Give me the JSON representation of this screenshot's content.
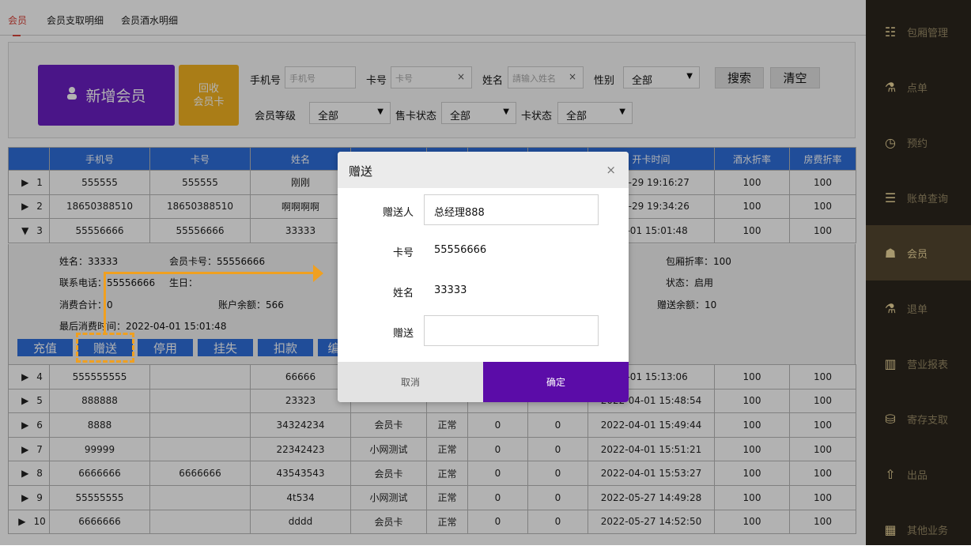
{
  "tabs": [
    "会员",
    "会员支取明细",
    "会员酒水明细"
  ],
  "buttons": {
    "new_member": "新增会员",
    "recycle_line1": "回收",
    "recycle_line2": "会员卡",
    "search": "搜索",
    "clear": "清空"
  },
  "filters": {
    "phone_label": "手机号",
    "phone_placeholder": "手机号",
    "card_label": "卡号",
    "card_placeholder": "卡号",
    "name_label": "姓名",
    "name_placeholder": "請输入姓名",
    "gender_label": "性别",
    "gender_value": "全部",
    "level_label": "会员等级",
    "level_value": "全部",
    "sale_status_label": "售卡状态",
    "sale_status_value": "全部",
    "card_status_label": "卡状态",
    "card_status_value": "全部"
  },
  "table": {
    "headers": [
      "手机号",
      "卡号",
      "姓名",
      "",
      "",
      "",
      "",
      "开卡时间",
      "酒水折率",
      "房费折率"
    ],
    "rows_top": [
      {
        "no": "1",
        "toggle": "▶",
        "phone": "555555",
        "card": "555555",
        "name": "刚刚",
        "type": "",
        "status": "",
        "c1": "",
        "c2": "",
        "time": "-12-29 19:16:27",
        "drink": "100",
        "room": "100"
      },
      {
        "no": "2",
        "toggle": "▶",
        "phone": "18650388510",
        "card": "18650388510",
        "name": "啊啊啊啊",
        "type": "",
        "status": "",
        "c1": "",
        "c2": "",
        "time": "-12-29 19:34:26",
        "drink": "100",
        "room": "100"
      },
      {
        "no": "3",
        "toggle": "▼",
        "phone": "55556666",
        "card": "55556666",
        "name": "33333",
        "type": "",
        "status": "",
        "c1": "",
        "c2": "",
        "time": "04-01 15:01:48",
        "drink": "100",
        "room": "100"
      }
    ],
    "rows_bottom": [
      {
        "no": "4",
        "toggle": "▶",
        "phone": "555555555",
        "card": "",
        "name": "66666",
        "type": "",
        "status": "",
        "c1": "",
        "c2": "",
        "time": "04-01 15:13:06",
        "drink": "100",
        "room": "100"
      },
      {
        "no": "5",
        "toggle": "▶",
        "phone": "888888",
        "card": "",
        "name": "23323",
        "type": "",
        "status": "",
        "c1": "",
        "c2": "",
        "time": "2022-04-01 15:48:54",
        "drink": "100",
        "room": "100"
      },
      {
        "no": "6",
        "toggle": "▶",
        "phone": "8888",
        "card": "",
        "name": "34324234",
        "type": "会员卡",
        "status": "正常",
        "c1": "0",
        "c2": "0",
        "time": "2022-04-01 15:49:44",
        "drink": "100",
        "room": "100"
      },
      {
        "no": "7",
        "toggle": "▶",
        "phone": "99999",
        "card": "",
        "name": "22342423",
        "type": "小网测试",
        "status": "正常",
        "c1": "0",
        "c2": "0",
        "time": "2022-04-01 15:51:21",
        "drink": "100",
        "room": "100"
      },
      {
        "no": "8",
        "toggle": "▶",
        "phone": "6666666",
        "card": "6666666",
        "name": "43543543",
        "type": "会员卡",
        "status": "正常",
        "c1": "0",
        "c2": "0",
        "time": "2022-04-01 15:53:27",
        "drink": "100",
        "room": "100"
      },
      {
        "no": "9",
        "toggle": "▶",
        "phone": "55555555",
        "card": "",
        "name": "4t534",
        "type": "小网测试",
        "status": "正常",
        "c1": "0",
        "c2": "0",
        "time": "2022-05-27 14:49:28",
        "drink": "100",
        "room": "100"
      },
      {
        "no": "10",
        "toggle": "▶",
        "phone": "6666666",
        "card": "",
        "name": "dddd",
        "type": "会员卡",
        "status": "正常",
        "c1": "0",
        "c2": "0",
        "time": "2022-05-27 14:52:50",
        "drink": "100",
        "room": "100"
      }
    ]
  },
  "detail": {
    "name": "姓名：33333",
    "card_no": "会员卡号：55556666",
    "phone": "联系电话：55556666",
    "birthday": "生日：",
    "consume_total": "消费合计：0",
    "balance": "账户余额：566",
    "last_consume": "最后消费时间：2022-04-01 15:01:48",
    "room_discount": "包厢折率：100",
    "state": "状态：启用",
    "gift_balance": "赠送余额：10",
    "actions": [
      "充值",
      "赠送",
      "停用",
      "挂失",
      "扣款",
      "编"
    ]
  },
  "dialog": {
    "title": "赠送",
    "close": "×",
    "giver_label": "赠送人",
    "giver_value": "总经理888",
    "card_label": "卡号",
    "card_value": "55556666",
    "name_label": "姓名",
    "name_value": "33333",
    "gift_label": "赠送",
    "gift_value": "",
    "cancel": "取消",
    "confirm": "确定"
  },
  "sidebar": [
    {
      "label": "包厢管理",
      "icon": "list-icon"
    },
    {
      "label": "点单",
      "icon": "order-icon"
    },
    {
      "label": "预约",
      "icon": "clock-icon"
    },
    {
      "label": "账单查询",
      "icon": "bill-icon"
    },
    {
      "label": "会员",
      "icon": "member-icon",
      "active": true
    },
    {
      "label": "退单",
      "icon": "return-icon"
    },
    {
      "label": "营业报表",
      "icon": "report-icon"
    },
    {
      "label": "寄存支取",
      "icon": "storage-icon"
    },
    {
      "label": "出品",
      "icon": "output-icon"
    },
    {
      "label": "其他业务",
      "icon": "grid-icon"
    }
  ],
  "colors": {
    "accent_purple": "#6a1fc3",
    "accent_gold": "#f4b321",
    "table_header_blue": "#2f6fdc",
    "confirm_purple": "#5b0ca8",
    "highlight_orange": "#f0a020",
    "sidebar_bg": "#1e1a14"
  }
}
